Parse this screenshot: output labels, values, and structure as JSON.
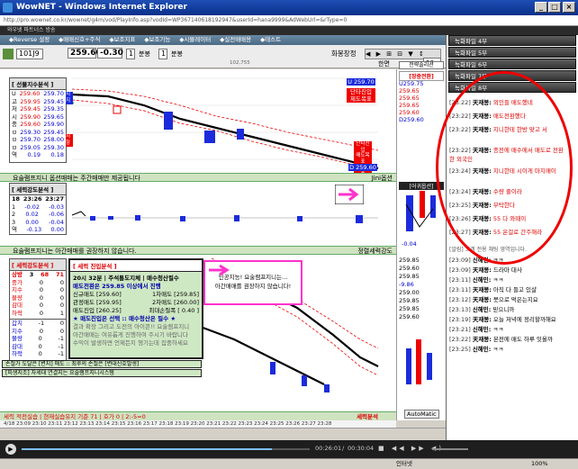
{
  "window": {
    "title": "WowNET - Windows Internet Explorer"
  },
  "address": {
    "url": "http://pro.wownet.co.kr/wownet/g4m/vod/PlayInfo.asp?vodId=WP367140618192947&userId=hana9999&AdWebUrl=&rType=0"
  },
  "topmenu": {
    "text": "와우넷 파트너스 방송"
  },
  "tabs": [
    "◆Reverse 설정",
    "◆매매신호+주식",
    "◆보조지표",
    "◆보조기능",
    "◆시뮬레이터",
    "◆실전매매용",
    "◆테스트"
  ],
  "toolbar": {
    "code": "101J9",
    "price": "259.60",
    "change": "-0.30",
    "interval1": "1",
    "interval_unit1": "분봉",
    "interval2": "1",
    "interval_unit2": "분봉",
    "view_label": "화봉창정",
    "jump_label": "한면",
    "count": "20",
    "volume": "102,755"
  },
  "panel1": {
    "title": "[ 선물지수분석 ]",
    "rows": [
      [
        "U",
        "259.60",
        "259.70"
      ],
      [
        "고",
        "259.95",
        "259.45"
      ],
      [
        "저",
        "259.45",
        "259.35"
      ],
      [
        "시",
        "259.90",
        "259.65"
      ],
      [
        "종",
        "259.60",
        "259.90"
      ],
      [
        "ㅁ",
        "259.30",
        "259.45"
      ],
      [
        "ㅁ",
        "259.70",
        "258.00"
      ],
      [
        "ㅁ",
        "259.05",
        "259.30"
      ],
      [
        "역",
        "0.19",
        "0.18"
      ]
    ],
    "side_labels": [
      "지지",
      "저항"
    ],
    "right_values": [
      "U 259.70",
      "단타진입",
      "제도목표",
      "D 259.60"
    ],
    "mini": [
      "U259.75",
      "259.65",
      "259.65",
      "259.65",
      "259.60",
      "D259.60"
    ],
    "mini_title": "[장중전환]",
    "mini_btn": "전략솔리션"
  },
  "strip1": {
    "left": "요술램프지니 옵션매매는 주간매매만 제공됩니다",
    "right": "Jini옵션"
  },
  "panel2": {
    "title": "[ 세력강도분석 ]",
    "head": [
      "18",
      "23:26",
      "23:27"
    ],
    "rows": [
      [
        "1",
        "-0.02",
        "-0.03"
      ],
      [
        "2",
        "0.02",
        "-0.06"
      ],
      [
        "3",
        "0.00",
        "-0.04"
      ],
      [
        "역",
        "-0.13",
        "0.00"
      ]
    ],
    "side_title": "[어귀옵션]",
    "side_vals": [
      "-0.04",
      "-0.04"
    ]
  },
  "strip2": {
    "left": "요술램프지니는 아간매매를 권장하지 않습니다.",
    "right": "정렬세력강도"
  },
  "panel3": {
    "title": "[ 세력강도분석 ]",
    "head": [
      "상방",
      "3",
      "68",
      "71"
    ],
    "rows": [
      [
        "중가",
        "0",
        "0"
      ],
      [
        "지수",
        "0",
        "0"
      ],
      [
        "물량",
        "0",
        "0"
      ],
      [
        "감대",
        "0",
        "0"
      ],
      [
        "하락",
        "0",
        "1"
      ]
    ],
    "rows2": [
      [
        "갑치",
        "-1",
        "0"
      ],
      [
        "지수",
        "0",
        "0"
      ],
      [
        "물량",
        "0",
        "-1"
      ],
      [
        "감대",
        "0",
        "-1"
      ],
      [
        "하락",
        "0",
        "-1"
      ]
    ],
    "side": [
      "259.85",
      "259.60",
      "259.85",
      "-9.86",
      "259.00",
      "259.85",
      "259.85",
      "259.60"
    ]
  },
  "greenbox": {
    "title": "[ 세력 진입분석 ]",
    "header": "20시 32분 | 주석통도지체 | 매수청산필수",
    "lines": [
      [
        "매도전환은 259.85 이상에서 진행",
        ""
      ],
      [
        "신규매도 [259.60]",
        "1차매도 [259.85]"
      ],
      [
        "관정매도 [259.95]",
        "2차매도 [260.00]"
      ],
      [
        "매도진입 [260.25]",
        "최대손절폭 [ 0.40 ]"
      ],
      [
        "★ 매도진입은 선택 :: 매수청산은 필수 ★",
        ""
      ],
      [
        "결과 확장 그리고 도전의 아이콘!! 요술램프지니",
        ""
      ],
      [
        "아간매매는 여유롭게 진행하여 주시기 바랍니다",
        ""
      ],
      [
        "수익이 발생하면 언제든지 챙기는데 집중하세요",
        ""
      ]
    ],
    "footer1": "손절가 도달은 [변지] 매도 :: 최후의 손절은 [변대신호발생]",
    "footer2": "[피생지조] 자세대 연결지는 요술램프지니시스템"
  },
  "overlay_note": {
    "line1": "인공지능! 요술램프지니는...",
    "line2": "아간매매를 권장하지 않습니다!"
  },
  "bottom": {
    "strip": "세력 적전실습 | 현재실습유지 기준 71 | 호가 0 | 2:-5=0",
    "strip_right": "세력분석",
    "timeaxis": "4/18 23:09  23:10  23:11  23:12  23:13  23:14  23:15  23:16  23:17  23:18  23:19  23:20  23:21  23:22  23:23  23:24  23:25  23:26  23:27  23:28",
    "automatic": "AutoMatic"
  },
  "sidebar": {
    "buttons": [
      "녹화파일 4부",
      "녹화파일 5부",
      "녹화파일 6부",
      "녹화파일 7부",
      "녹화파일 8부"
    ],
    "chat": [
      {
        "time": "[23:22]",
        "name": "天재봉:",
        "msg": "외인들 매도했네"
      },
      {
        "time": "[23:22]",
        "name": "天재봉:",
        "msg": "매도전환했다"
      },
      {
        "time": "[23:22]",
        "name": "天재봉:",
        "msg": "지니한테 한방 맞고 서"
      },
      {
        "time": "[23:22]",
        "name": "天재봉:",
        "msg": "종전에 매수에서 매도로 전환한 외국인"
      },
      {
        "time": "[23:24]",
        "name": "天재봉:",
        "msg": "지니한테 시이게 마지매이"
      },
      {
        "time": "[23:24]",
        "name": "天재봉:",
        "msg": "수량 줄이라"
      },
      {
        "time": "[23:25]",
        "name": "天재봉:",
        "msg": "부탁한다"
      },
      {
        "time": "[23:26]",
        "name": "天재봉:",
        "msg": "55 다 와때이"
      },
      {
        "time": "[23:27]",
        "name": "天재봉:",
        "msg": "55 온걸로 간주해라"
      }
    ],
    "notice": "[알림] 고객 전용 채팅 영역입니다.",
    "chat2": [
      {
        "time": "[23:09]",
        "name": "신해민:",
        "msg": "ㅋㅋ"
      },
      {
        "time": "[23:09]",
        "name": "天재봉:",
        "msg": "드라마 대사"
      },
      {
        "time": "[23:11]",
        "name": "신해민:",
        "msg": "ㅋㅋ"
      },
      {
        "time": "[23:11]",
        "name": "天재봉:",
        "msg": "아직 다 들고 있샬"
      },
      {
        "time": "[23:12]",
        "name": "天재봉:",
        "msg": "뭇으로 먹은는지요"
      },
      {
        "time": "[23:13]",
        "name": "신해민:",
        "msg": "믿으니까"
      },
      {
        "time": "[23:19]",
        "name": "天재봉:",
        "msg": "오늘 저녁에 정리할까해요"
      },
      {
        "time": "[23:21]",
        "name": "신해민:",
        "msg": "ㅋㅋ"
      },
      {
        "time": "[23:22]",
        "name": "天재봉:",
        "msg": "본전에 매도 하루 잇올까"
      },
      {
        "time": "[23:25]",
        "name": "신해민:",
        "msg": "ㅋㅋ"
      }
    ]
  },
  "player": {
    "time": "00:26:01",
    "total": "00:30:04"
  },
  "statusbar": {
    "zone": "인터넷",
    "zoom": "100%"
  },
  "colors": {
    "up": "#dd0000",
    "down": "#0000cc",
    "accent": "#ff33cc"
  }
}
